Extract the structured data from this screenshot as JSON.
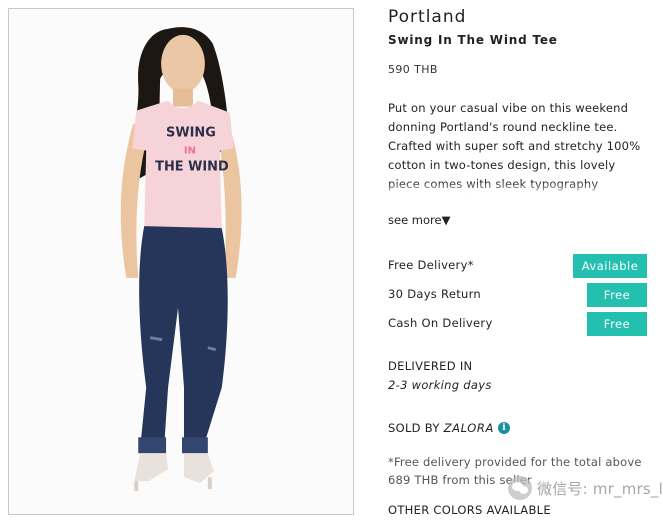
{
  "product": {
    "brand": "Portland",
    "name": "Swing In The Wind Tee",
    "price": "590 THB",
    "description": "Put on your casual vibe on this weekend donning Portland's round neckline tee. Crafted with super soft and stretchy 100% cotton in two-tones design, this lovely piece comes with sleek typography emerging to finish on its stylish look.",
    "see_more_label": "see more▼",
    "tee_print": {
      "line1": "SWING",
      "line2": "IN",
      "line3": "THE WIND"
    }
  },
  "services": [
    {
      "label": "Free Delivery*",
      "badge": "Available"
    },
    {
      "label": "30 Days Return",
      "badge": "Free"
    },
    {
      "label": "Cash On Delivery",
      "badge": "Free"
    }
  ],
  "delivery": {
    "title": "DELIVERED IN",
    "value": "2-3 working days"
  },
  "seller": {
    "prefix": "SOLD BY",
    "name": "ZALORA",
    "info_icon": "i"
  },
  "delivery_note": "*Free delivery provided for the total above 689 THB from this seller",
  "other_colors_label": "OTHER COLORS AVAILABLE",
  "watermark": {
    "icon": "wechat-icon",
    "text": "微信号: mr_mrs_li"
  },
  "colors": {
    "accent": "#23c0b0",
    "info": "#1b8fa0",
    "tee": "#f6d3d8",
    "denim": "#26365a"
  }
}
